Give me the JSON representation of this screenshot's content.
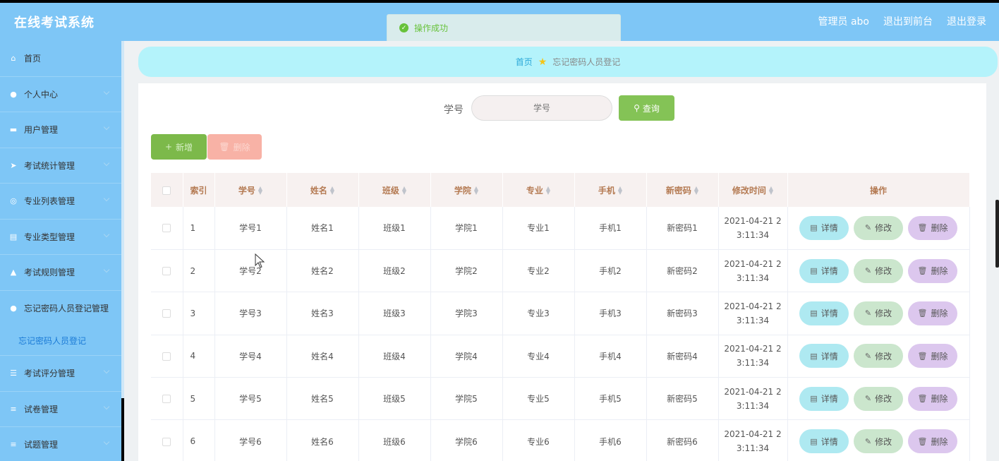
{
  "app": {
    "title": "在线考试系统"
  },
  "header": {
    "user": "管理员 abo",
    "front": "退出到前台",
    "logout": "退出登录"
  },
  "toast": {
    "message": "操作成功"
  },
  "sidebar": {
    "items": [
      {
        "label": "首页",
        "icon": "home-icon"
      },
      {
        "label": "个人中心",
        "icon": "user-icon"
      },
      {
        "label": "用户管理",
        "icon": "users-icon"
      },
      {
        "label": "考试统计管理",
        "icon": "send-icon"
      },
      {
        "label": "专业列表管理",
        "icon": "compass-icon"
      },
      {
        "label": "专业类型管理",
        "icon": "clipboard-icon"
      },
      {
        "label": "考试规则管理",
        "icon": "thumb-icon"
      },
      {
        "label": "忘记密码人员登记管理",
        "icon": "person-icon"
      },
      {
        "label": "考试评分管理",
        "icon": "sliders-icon"
      },
      {
        "label": "试卷管理",
        "icon": "list-icon"
      },
      {
        "label": "试题管理",
        "icon": "list-icon"
      }
    ],
    "sub_item": "忘记密码人员登记"
  },
  "breadcrumb": {
    "home": "首页",
    "current": "忘记密码人员登记"
  },
  "search": {
    "label": "学号",
    "placeholder": "学号",
    "button": "查询"
  },
  "actions": {
    "add": "新增",
    "delete": "删除"
  },
  "table": {
    "headers": [
      "索引",
      "学号",
      "姓名",
      "班级",
      "学院",
      "专业",
      "手机",
      "新密码",
      "修改时间",
      "操作"
    ],
    "rows": [
      {
        "index": "1",
        "sno": "学号1",
        "name": "姓名1",
        "cls": "班级1",
        "college": "学院1",
        "major": "专业1",
        "phone": "手机1",
        "pwd": "新密码1",
        "time1": "2021-04-21 2",
        "time2": "3:11:34"
      },
      {
        "index": "2",
        "sno": "学号2",
        "name": "姓名2",
        "cls": "班级2",
        "college": "学院2",
        "major": "专业2",
        "phone": "手机2",
        "pwd": "新密码2",
        "time1": "2021-04-21 2",
        "time2": "3:11:34"
      },
      {
        "index": "3",
        "sno": "学号3",
        "name": "姓名3",
        "cls": "班级3",
        "college": "学院3",
        "major": "专业3",
        "phone": "手机3",
        "pwd": "新密码3",
        "time1": "2021-04-21 2",
        "time2": "3:11:34"
      },
      {
        "index": "4",
        "sno": "学号4",
        "name": "姓名4",
        "cls": "班级4",
        "college": "学院4",
        "major": "专业4",
        "phone": "手机4",
        "pwd": "新密码4",
        "time1": "2021-04-21 2",
        "time2": "3:11:34"
      },
      {
        "index": "5",
        "sno": "学号5",
        "name": "姓名5",
        "cls": "班级5",
        "college": "学院5",
        "major": "专业5",
        "phone": "手机5",
        "pwd": "新密码5",
        "time1": "2021-04-21 2",
        "time2": "3:11:34"
      },
      {
        "index": "6",
        "sno": "学号6",
        "name": "姓名6",
        "cls": "班级6",
        "college": "学院6",
        "major": "专业6",
        "phone": "手机6",
        "pwd": "新密码6",
        "time1": "2021-04-21 2",
        "time2": "3:11:34"
      }
    ],
    "op_detail": "详情",
    "op_edit": "修改",
    "op_delete": "删除"
  },
  "colors": {
    "header": "#7ec6f6",
    "breadcrumb": "#b4f3fb",
    "query": "#84c356",
    "add": "#7cb94a",
    "delete": "#f8b2a6"
  }
}
